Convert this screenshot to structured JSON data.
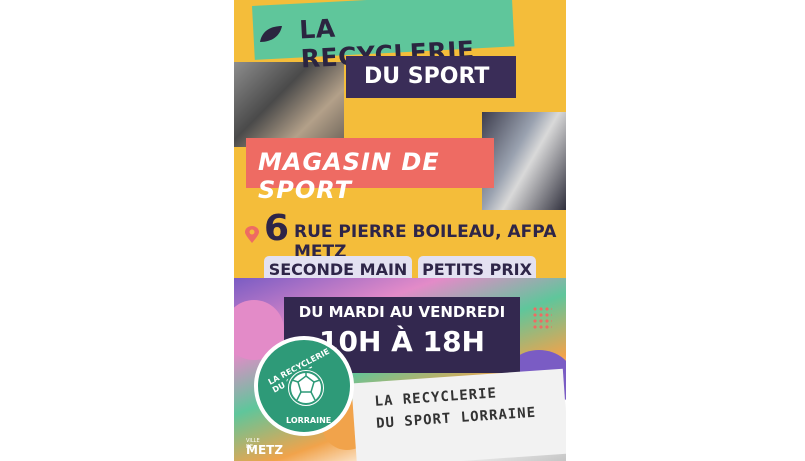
{
  "title_line1": "LA RECYCLERIE",
  "title_line2": "DU SPORT",
  "subtitle": "MAGASIN DE SPORT",
  "address_number": "6",
  "address_text": "RUE PIERRE BOILEAU, AFPA METZ",
  "tags": [
    "SECONDE MAIN",
    "PETITS PRIX"
  ],
  "hours_days": "DU MARDI AU VENDREDI",
  "hours_time": "10H À 18H",
  "seal_top": "LA RECYCLERIE DU SPORT",
  "seal_bottom": "LORRAINE",
  "wall_line1": "LA RECYCLERIE",
  "wall_line2": "DU SPORT LORRAINE",
  "city_logo_small": "VILLE DE",
  "city_logo_big": "METZ",
  "colors": {
    "background": "#f4bd3a",
    "green": "#5fc69b",
    "navy": "#3a2d58",
    "coral": "#ee6b63",
    "pill": "#e3e1f1"
  },
  "icons": [
    "leaf-icon",
    "location-pin-icon",
    "soccer-ball-icon"
  ]
}
